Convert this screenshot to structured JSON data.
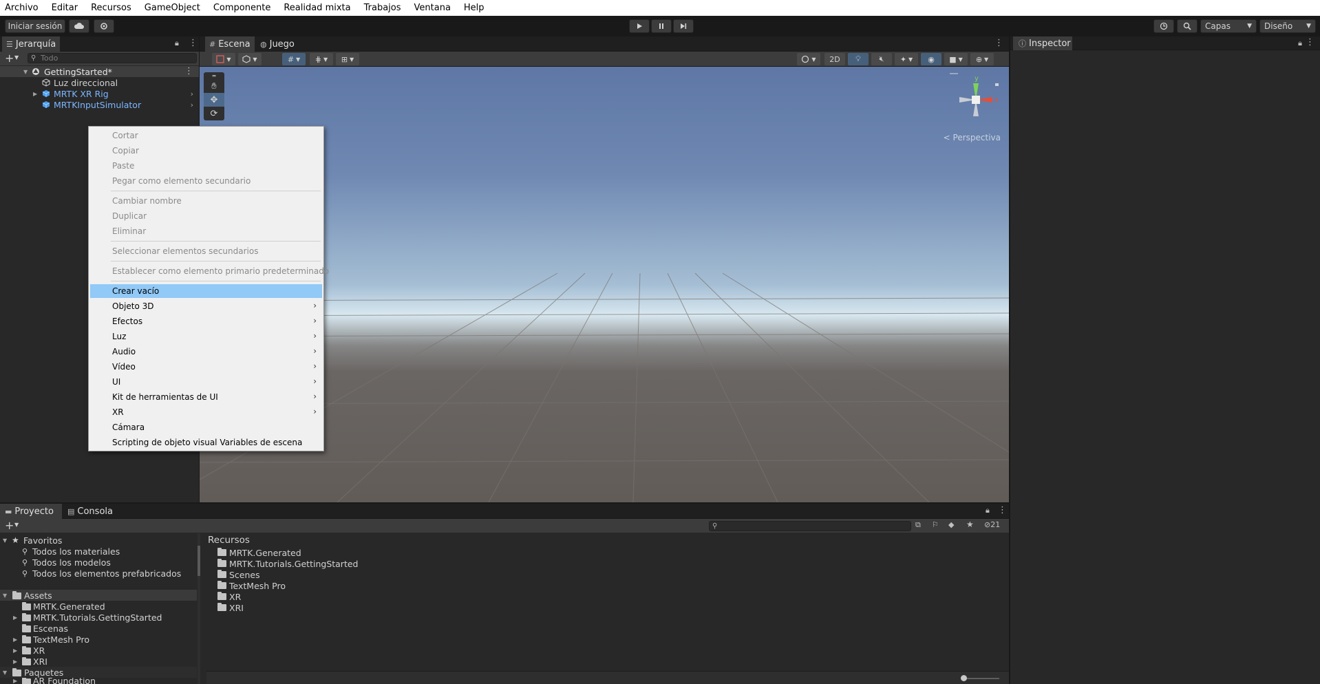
{
  "menubar": {
    "items": [
      "Archivo",
      "Editar",
      "Recursos",
      "GameObject",
      "Componente",
      "Realidad mixta",
      "Trabajos",
      "Ventana",
      "Help"
    ]
  },
  "toolbar": {
    "login_label": "Iniciar sesión",
    "layers_label": "Capas",
    "layout_label": "Diseño"
  },
  "hierarchy": {
    "tab_label": "Jerarquía",
    "search_placeholder": "Todo",
    "scene_name": "GettingStarted*",
    "items": [
      {
        "label": "Luz direccional"
      },
      {
        "label": "MRTK XR Rig"
      },
      {
        "label": "MRTKInputSimulator"
      }
    ]
  },
  "scene_view": {
    "tab_scene": "Escena",
    "tab_game": "Juego",
    "btn_2d": "2D",
    "gizmo_y": "y",
    "gizmo_x": "x",
    "perspective_label": "< Perspectiva"
  },
  "inspector": {
    "tab_label": "Inspector"
  },
  "context_menu": {
    "group1": [
      "Cortar",
      "Copiar",
      "Paste",
      "Pegar como elemento secundario"
    ],
    "group2": [
      "Cambiar nombre",
      "Duplicar",
      "Eliminar"
    ],
    "group3": [
      "Seleccionar elementos secundarios"
    ],
    "group4": [
      "Establecer como elemento primario predeterminado"
    ],
    "create_empty": "Crear vacío",
    "submenus": [
      "Objeto 3D",
      "Efectos",
      "Luz",
      "Audio",
      "Vídeo",
      "UI",
      "Kit de herramientas de UI",
      "XR"
    ],
    "bottom": [
      "Cámara",
      "Scripting de objeto visual Variables de escena"
    ]
  },
  "project": {
    "tab_project": "Proyecto",
    "tab_console": "Consola",
    "hidden_count": "21",
    "favorites_label": "Favoritos",
    "favorites": [
      "Todos los materiales",
      "Todos los modelos",
      "Todos los elementos prefabricados"
    ],
    "assets_label": "Assets",
    "assets": [
      "MRTK.Generated",
      "MRTK.Tutorials.GettingStarted",
      "Escenas",
      "TextMesh Pro",
      "XR",
      "XRI"
    ],
    "packages_label": "Paquetes",
    "packages": [
      "AR Foundation"
    ],
    "right_title": "Recursos",
    "right_items": [
      "MRTK.Generated",
      "MRTK.Tutorials.GettingStarted",
      "Scenes",
      "TextMesh Pro",
      "XR",
      "XRI"
    ]
  }
}
